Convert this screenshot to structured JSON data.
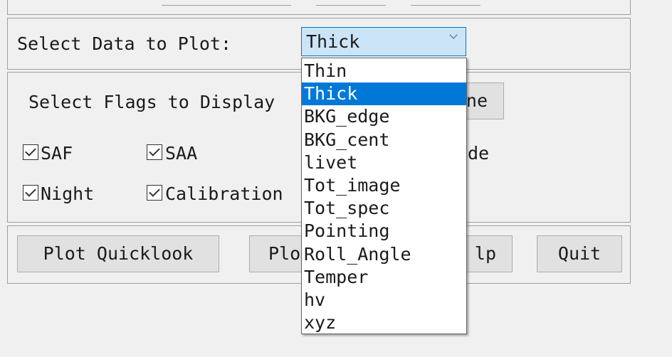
{
  "data_select": {
    "label": "Select Data to Plot:",
    "value": "Thick",
    "options": [
      "Thin",
      "Thick",
      "BKG_edge",
      "BKG_cent",
      "livet",
      "Tot_image",
      "Tot_spec",
      "Pointing",
      "Roll_Angle",
      "Temper",
      "hv",
      "xyz"
    ]
  },
  "flags": {
    "label": "Select Flags to Display",
    "button_partial": "ne",
    "checkboxes": [
      {
        "label": "SAF",
        "checked": true
      },
      {
        "label": "SAA",
        "checked": true
      },
      {
        "label": "Night",
        "checked": true
      },
      {
        "label": "Calibration",
        "checked": true
      }
    ],
    "partial_text": "de"
  },
  "buttons": {
    "plot_quicklook": "Plot Quicklook",
    "plot_partial": "Plo",
    "help_partial": "lp",
    "quit": "Quit"
  },
  "colors": {
    "accent": "#0078d7",
    "selected_bg": "#cce4f7"
  }
}
